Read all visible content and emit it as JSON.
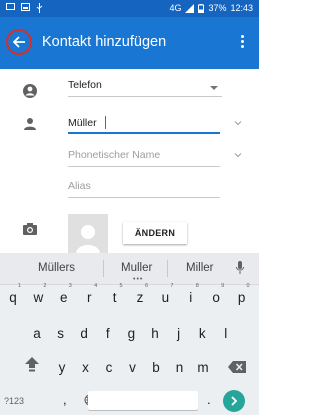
{
  "status_bar": {
    "network": "4G",
    "battery": "37%",
    "time": "12:43"
  },
  "app_bar": {
    "title": "Kontakt hinzufügen"
  },
  "form": {
    "phone_type": "Telefon",
    "name_value": "Müller",
    "phonetic_placeholder": "Phonetischer Name",
    "alias_placeholder": "Alias",
    "change_button": "ÄNDERN"
  },
  "keyboard": {
    "suggestions": [
      "Müllers",
      "Muller",
      "Miller"
    ],
    "row1": [
      {
        "k": "q",
        "n": "1"
      },
      {
        "k": "w",
        "n": "2"
      },
      {
        "k": "e",
        "n": "3"
      },
      {
        "k": "r",
        "n": "4"
      },
      {
        "k": "t",
        "n": "5"
      },
      {
        "k": "z",
        "n": "6"
      },
      {
        "k": "u",
        "n": "7"
      },
      {
        "k": "i",
        "n": "8"
      },
      {
        "k": "o",
        "n": "9"
      },
      {
        "k": "p",
        "n": "0"
      }
    ],
    "row2": [
      "a",
      "s",
      "d",
      "f",
      "g",
      "h",
      "j",
      "k",
      "l"
    ],
    "row3": [
      "y",
      "x",
      "c",
      "v",
      "b",
      "n",
      "m"
    ],
    "symbols_label": "?123",
    "comma": ",",
    "period": "."
  },
  "colors": {
    "primary": "#1976d2",
    "primary_dark": "#1565c0",
    "accent_go": "#26a69a",
    "highlight_circle": "#d32f2f"
  }
}
